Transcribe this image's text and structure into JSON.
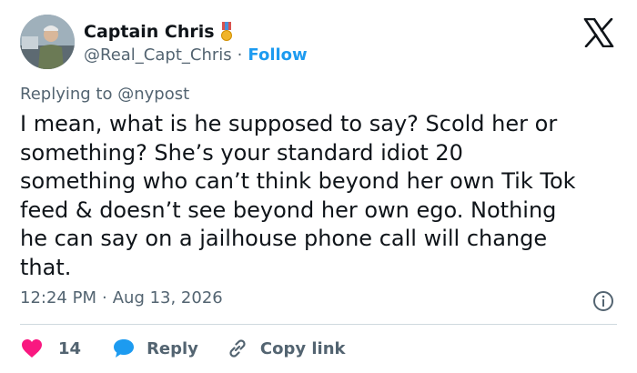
{
  "author": {
    "display_name": "Captain Chris",
    "handle": "@Real_Capt_Chris",
    "separator": "·",
    "follow_label": "Follow"
  },
  "reply_context": {
    "prefix": "Replying to",
    "mention": "@nypost"
  },
  "tweet": {
    "text": "I mean, what is he supposed to say? Scold her or\nsomething? She’s your standard idiot 20\nsomething who can’t think beyond her own Tik Tok\nfeed & doesn’t see beyond her own ego. Nothing\nhe can say on a jailhouse phone call will change\nthat.",
    "time": "12:24 PM",
    "separator": "·",
    "date": "Aug 13, 2026"
  },
  "actions": {
    "like_count": "14",
    "reply_label": "Reply",
    "copy_link_label": "Copy link"
  },
  "icons": {
    "badge": "military-medal-icon",
    "logo": "x-logo-icon",
    "info": "info-icon",
    "like": "heart-icon",
    "reply": "speech-bubble-icon",
    "copy": "link-icon"
  },
  "colors": {
    "accent": "#1d9bf0",
    "like": "#f91880",
    "text": "#0f1419",
    "muted": "#536471",
    "divider": "#cfd9de"
  }
}
